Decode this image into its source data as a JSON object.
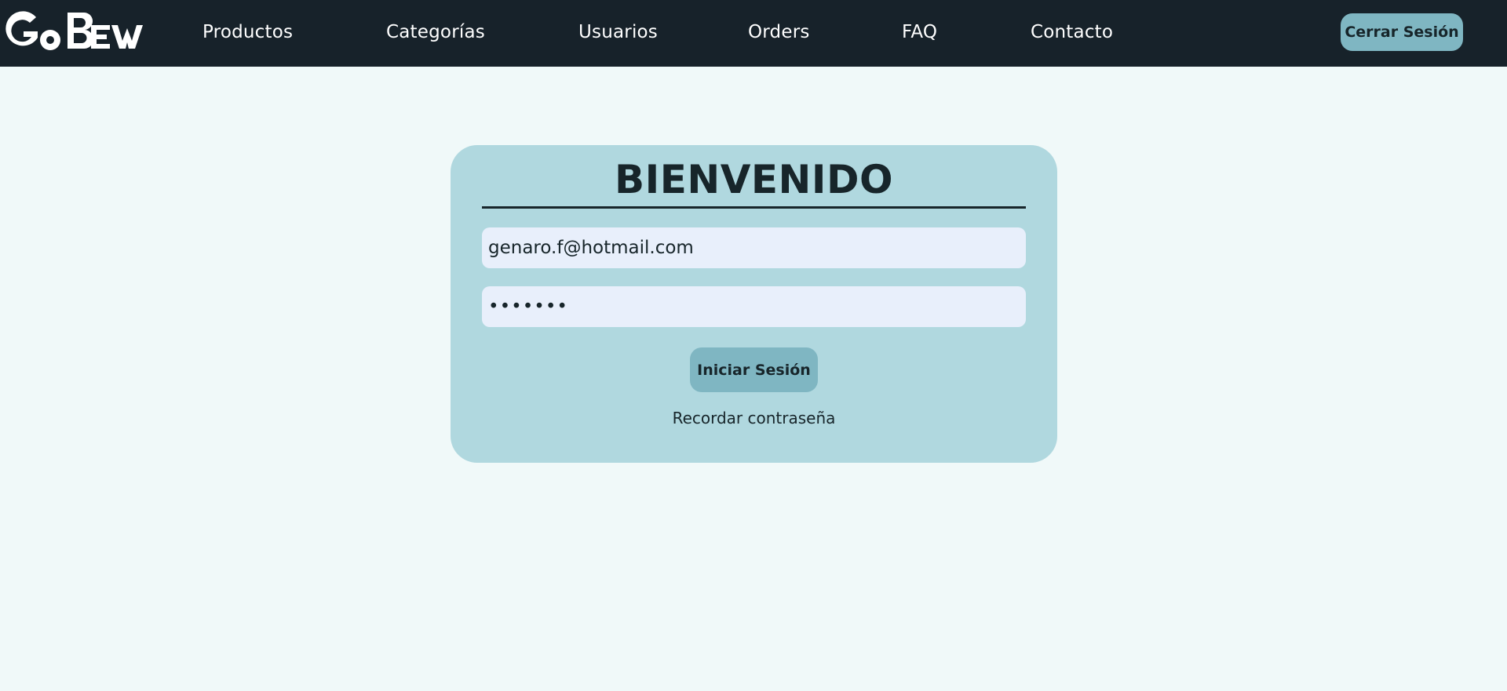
{
  "header": {
    "brand": "GoBew",
    "nav": [
      "Productos",
      "Categorías",
      "Usuarios",
      "Orders",
      "FAQ",
      "Contacto"
    ],
    "logout_label": "Cerrar Sesión"
  },
  "login": {
    "title": "BIENVENIDO",
    "email_value": "genaro.f@hotmail.com",
    "password_value": "•••••••",
    "submit_label": "Iniciar Sesión",
    "recover_label": "Recordar contraseña"
  },
  "colors": {
    "navbar": "#17222a",
    "page_bg": "#f0f9f9",
    "card_bg": "#b0d8df",
    "button": "#7fb6c2",
    "input_bg": "#e8effb",
    "text_dark": "#17252a"
  }
}
